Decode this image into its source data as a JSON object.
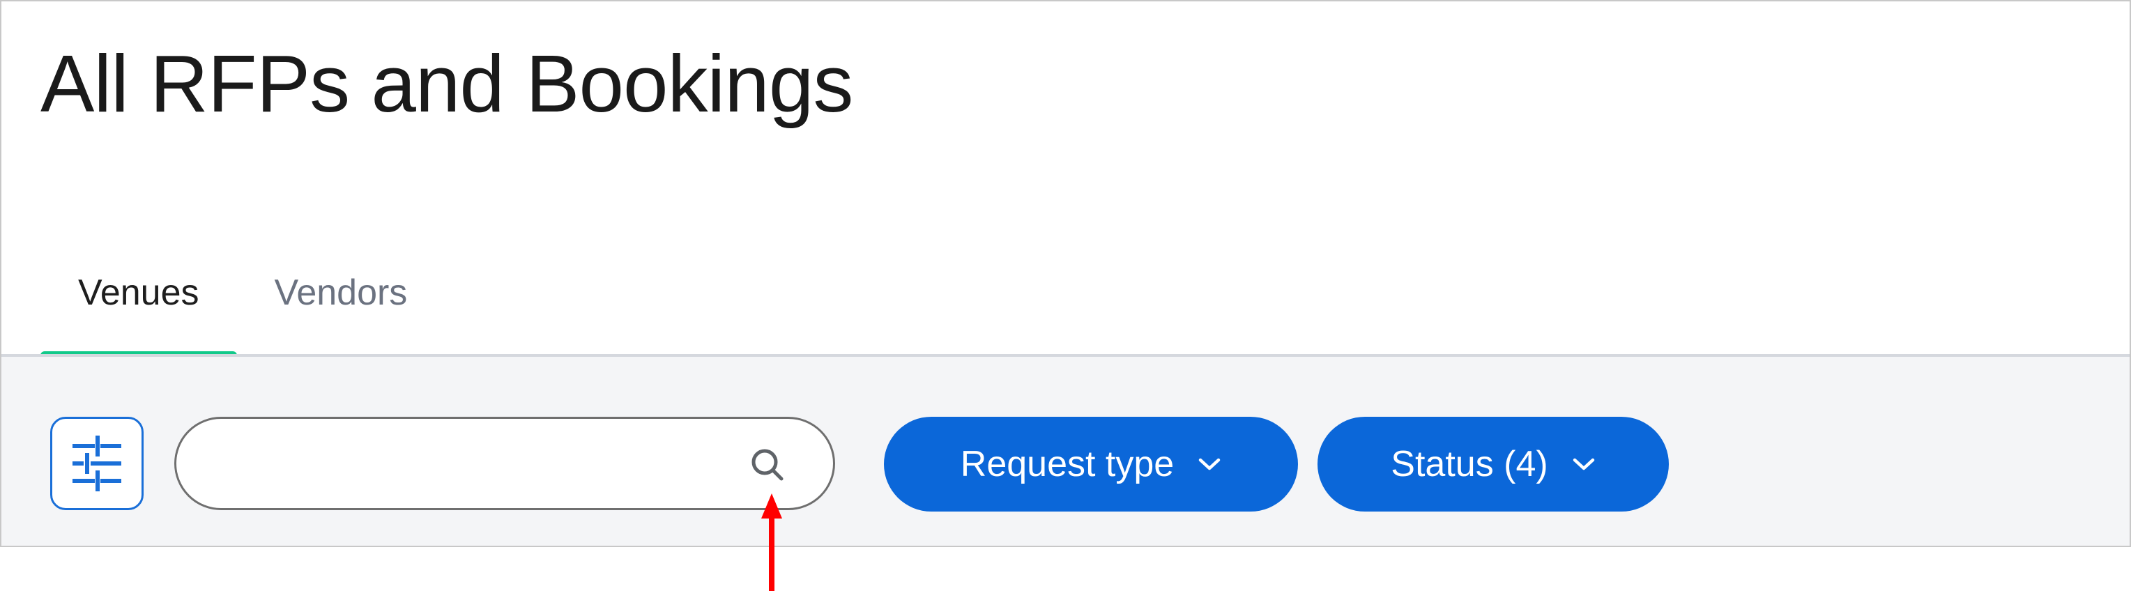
{
  "page": {
    "title": "All RFPs and Bookings"
  },
  "tabs": [
    {
      "label": "Venues",
      "active": true
    },
    {
      "label": "Vendors",
      "active": false
    }
  ],
  "toolbar": {
    "filter_icon": "sliders-icon",
    "search": {
      "value": "",
      "placeholder": "",
      "icon": "search-icon"
    },
    "request_type_label": "Request type",
    "status_label": "Status (4)",
    "dropdown_icon": "chevron-down-icon"
  },
  "colors": {
    "accent_blue": "#0b67d9",
    "tab_underline": "#12c98a",
    "annotation_arrow": "#ff0000"
  }
}
